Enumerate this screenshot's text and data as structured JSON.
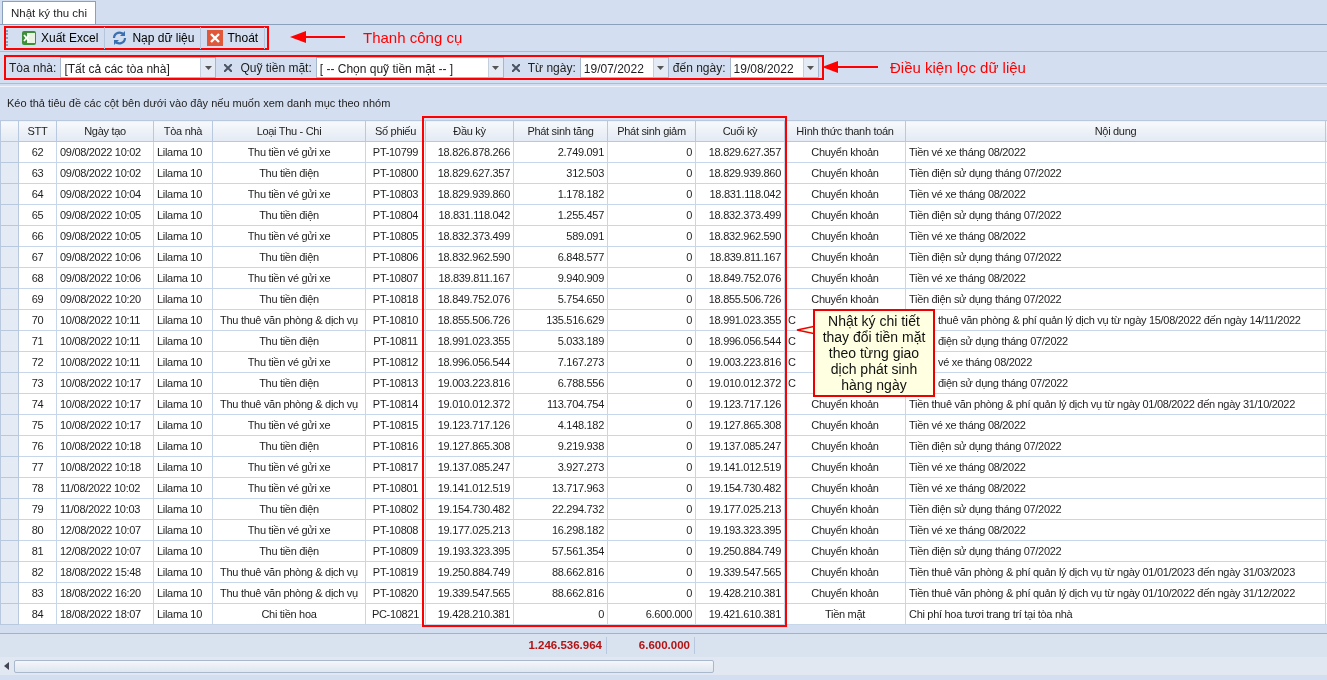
{
  "tabs": [
    {
      "label": "Nhật ký thu chi",
      "selected": true
    }
  ],
  "toolbar": {
    "buttons": [
      {
        "kind": "excel",
        "label": "Xuất Excel"
      },
      {
        "kind": "reload",
        "label": "Nạp dữ liệu"
      },
      {
        "kind": "exit",
        "label": "Thoát"
      }
    ],
    "note": "Thanh công cụ"
  },
  "filters": {
    "building": {
      "label": "Tòa nhà:",
      "value": "[Tất cả các tòa nhà]"
    },
    "cash_fund": {
      "label": "Quỹ tiền mặt:",
      "value": "[ -- Chọn quỹ tiền mặt -- ]"
    },
    "date_from": {
      "label": "Từ ngày:",
      "value": "19/07/2022"
    },
    "date_to": {
      "label": "đến ngày:",
      "value": "19/08/2022"
    },
    "note": "Điều kiện lọc dữ liệu"
  },
  "grid": {
    "group_hint": "Kéo thả tiêu đề các cột bên dưới vào đây nếu muốn xem danh mục theo nhóm",
    "columns": [
      "STT",
      "Ngày tạo",
      "Tòa nhà",
      "Loại Thu - Chi",
      "Số phiếu",
      "Đầu kỳ",
      "Phát sinh tăng",
      "Phát sinh giảm",
      "Cuối kỳ",
      "Hình thức thanh toán",
      "Nội dung"
    ],
    "rows": [
      {
        "stt": "62",
        "created": "09/08/2022 10:02",
        "building": "Lilama 10",
        "type": "Thu tiền vé gửi xe",
        "voucher": "PT-10799",
        "opening": "18.826.878.266",
        "increase": "2.749.091",
        "decrease": "0",
        "closing": "18.829.627.357",
        "payment": "Chuyển khoản",
        "content": "Tiền vé xe tháng 08/2022",
        "covered": false
      },
      {
        "stt": "63",
        "created": "09/08/2022 10:02",
        "building": "Lilama 10",
        "type": "Thu tiền điện",
        "voucher": "PT-10800",
        "opening": "18.829.627.357",
        "increase": "312.503",
        "decrease": "0",
        "closing": "18.829.939.860",
        "payment": "Chuyển khoản",
        "content": "Tiền điện sử dụng tháng 07/2022",
        "covered": false
      },
      {
        "stt": "64",
        "created": "09/08/2022 10:04",
        "building": "Lilama 10",
        "type": "Thu tiền vé gửi xe",
        "voucher": "PT-10803",
        "opening": "18.829.939.860",
        "increase": "1.178.182",
        "decrease": "0",
        "closing": "18.831.118.042",
        "payment": "Chuyển khoản",
        "content": "Tiền vé xe tháng 08/2022",
        "covered": false
      },
      {
        "stt": "65",
        "created": "09/08/2022 10:05",
        "building": "Lilama 10",
        "type": "Thu tiền điện",
        "voucher": "PT-10804",
        "opening": "18.831.118.042",
        "increase": "1.255.457",
        "decrease": "0",
        "closing": "18.832.373.499",
        "payment": "Chuyển khoản",
        "content": "Tiền điện sử dụng tháng 07/2022",
        "covered": false
      },
      {
        "stt": "66",
        "created": "09/08/2022 10:05",
        "building": "Lilama 10",
        "type": "Thu tiền vé gửi xe",
        "voucher": "PT-10805",
        "opening": "18.832.373.499",
        "increase": "589.091",
        "decrease": "0",
        "closing": "18.832.962.590",
        "payment": "Chuyển khoản",
        "content": "Tiền vé xe tháng 08/2022",
        "covered": false
      },
      {
        "stt": "67",
        "created": "09/08/2022 10:06",
        "building": "Lilama 10",
        "type": "Thu tiền điện",
        "voucher": "PT-10806",
        "opening": "18.832.962.590",
        "increase": "6.848.577",
        "decrease": "0",
        "closing": "18.839.811.167",
        "payment": "Chuyển khoản",
        "content": "Tiền điện sử dụng tháng 07/2022",
        "covered": false
      },
      {
        "stt": "68",
        "created": "09/08/2022 10:06",
        "building": "Lilama 10",
        "type": "Thu tiền vé gửi xe",
        "voucher": "PT-10807",
        "opening": "18.839.811.167",
        "increase": "9.940.909",
        "decrease": "0",
        "closing": "18.849.752.076",
        "payment": "Chuyển khoản",
        "content": "Tiền vé xe tháng 08/2022",
        "covered": false
      },
      {
        "stt": "69",
        "created": "09/08/2022 10:20",
        "building": "Lilama 10",
        "type": "Thu tiền điện",
        "voucher": "PT-10818",
        "opening": "18.849.752.076",
        "increase": "5.754.650",
        "decrease": "0",
        "closing": "18.855.506.726",
        "payment": "Chuyển khoản",
        "content": "Tiền điện sử dụng tháng 07/2022",
        "covered": false
      },
      {
        "stt": "70",
        "created": "10/08/2022 10:11",
        "building": "Lilama 10",
        "type": "Thu thuê văn phòng & dịch vụ",
        "voucher": "PT-10810",
        "opening": "18.855.506.726",
        "increase": "135.516.629",
        "decrease": "0",
        "closing": "18.991.023.355",
        "payment": "C",
        "content": "thuê văn phòng & phí quản lý dịch vụ từ ngày 15/08/2022 đến ngày 14/11/2022",
        "covered": true
      },
      {
        "stt": "71",
        "created": "10/08/2022 10:11",
        "building": "Lilama 10",
        "type": "Thu tiền điện",
        "voucher": "PT-10811",
        "opening": "18.991.023.355",
        "increase": "5.033.189",
        "decrease": "0",
        "closing": "18.996.056.544",
        "payment": "C",
        "content": "điện sử dụng tháng 07/2022",
        "covered": true
      },
      {
        "stt": "72",
        "created": "10/08/2022 10:11",
        "building": "Lilama 10",
        "type": "Thu tiền vé gửi xe",
        "voucher": "PT-10812",
        "opening": "18.996.056.544",
        "increase": "7.167.273",
        "decrease": "0",
        "closing": "19.003.223.816",
        "payment": "C",
        "content": "vé xe tháng 08/2022",
        "covered": true
      },
      {
        "stt": "73",
        "created": "10/08/2022 10:17",
        "building": "Lilama 10",
        "type": "Thu tiền điện",
        "voucher": "PT-10813",
        "opening": "19.003.223.816",
        "increase": "6.788.556",
        "decrease": "0",
        "closing": "19.010.012.372",
        "payment": "C",
        "content": "điện sử dụng tháng 07/2022",
        "covered": true
      },
      {
        "stt": "74",
        "created": "10/08/2022 10:17",
        "building": "Lilama 10",
        "type": "Thu thuê văn phòng & dịch vụ",
        "voucher": "PT-10814",
        "opening": "19.010.012.372",
        "increase": "113.704.754",
        "decrease": "0",
        "closing": "19.123.717.126",
        "payment": "Chuyển khoản",
        "content": "Tiền thuê văn phòng & phí quản lý dịch vụ từ ngày 01/08/2022 đến ngày 31/10/2022",
        "covered": false
      },
      {
        "stt": "75",
        "created": "10/08/2022 10:17",
        "building": "Lilama 10",
        "type": "Thu tiền vé gửi xe",
        "voucher": "PT-10815",
        "opening": "19.123.717.126",
        "increase": "4.148.182",
        "decrease": "0",
        "closing": "19.127.865.308",
        "payment": "Chuyển khoản",
        "content": "Tiền vé xe tháng 08/2022",
        "covered": false
      },
      {
        "stt": "76",
        "created": "10/08/2022 10:18",
        "building": "Lilama 10",
        "type": "Thu tiền điện",
        "voucher": "PT-10816",
        "opening": "19.127.865.308",
        "increase": "9.219.938",
        "decrease": "0",
        "closing": "19.137.085.247",
        "payment": "Chuyển khoản",
        "content": "Tiền điện sử dụng tháng 07/2022",
        "covered": false
      },
      {
        "stt": "77",
        "created": "10/08/2022 10:18",
        "building": "Lilama 10",
        "type": "Thu tiền vé gửi xe",
        "voucher": "PT-10817",
        "opening": "19.137.085.247",
        "increase": "3.927.273",
        "decrease": "0",
        "closing": "19.141.012.519",
        "payment": "Chuyển khoản",
        "content": "Tiền vé xe tháng 08/2022",
        "covered": false
      },
      {
        "stt": "78",
        "created": "11/08/2022 10:02",
        "building": "Lilama 10",
        "type": "Thu tiền vé gửi xe",
        "voucher": "PT-10801",
        "opening": "19.141.012.519",
        "increase": "13.717.963",
        "decrease": "0",
        "closing": "19.154.730.482",
        "payment": "Chuyển khoản",
        "content": "Tiền vé xe tháng 08/2022",
        "covered": false
      },
      {
        "stt": "79",
        "created": "11/08/2022 10:03",
        "building": "Lilama 10",
        "type": "Thu tiền điện",
        "voucher": "PT-10802",
        "opening": "19.154.730.482",
        "increase": "22.294.732",
        "decrease": "0",
        "closing": "19.177.025.213",
        "payment": "Chuyển khoản",
        "content": "Tiền điện sử dụng tháng 07/2022",
        "covered": false
      },
      {
        "stt": "80",
        "created": "12/08/2022 10:07",
        "building": "Lilama 10",
        "type": "Thu tiền vé gửi xe",
        "voucher": "PT-10808",
        "opening": "19.177.025.213",
        "increase": "16.298.182",
        "decrease": "0",
        "closing": "19.193.323.395",
        "payment": "Chuyển khoản",
        "content": "Tiền vé xe tháng 08/2022",
        "covered": false
      },
      {
        "stt": "81",
        "created": "12/08/2022 10:07",
        "building": "Lilama 10",
        "type": "Thu tiền điện",
        "voucher": "PT-10809",
        "opening": "19.193.323.395",
        "increase": "57.561.354",
        "decrease": "0",
        "closing": "19.250.884.749",
        "payment": "Chuyển khoản",
        "content": "Tiền điện sử dụng tháng 07/2022",
        "covered": false
      },
      {
        "stt": "82",
        "created": "18/08/2022 15:48",
        "building": "Lilama 10",
        "type": "Thu thuê văn phòng & dịch vụ",
        "voucher": "PT-10819",
        "opening": "19.250.884.749",
        "increase": "88.662.816",
        "decrease": "0",
        "closing": "19.339.547.565",
        "payment": "Chuyển khoản",
        "content": "Tiền thuê văn phòng & phí quản lý dịch vụ từ ngày 01/01/2023 đến ngày 31/03/2023",
        "covered": false
      },
      {
        "stt": "83",
        "created": "18/08/2022 16:20",
        "building": "Lilama 10",
        "type": "Thu thuê văn phòng & dịch vụ",
        "voucher": "PT-10820",
        "opening": "19.339.547.565",
        "increase": "88.662.816",
        "decrease": "0",
        "closing": "19.428.210.381",
        "payment": "Chuyển khoản",
        "content": "Tiền thuê văn phòng & phí quản lý dịch vụ từ ngày 01/10/2022 đến ngày 31/12/2022",
        "covered": false
      },
      {
        "stt": "84",
        "created": "18/08/2022 18:07",
        "building": "Lilama 10",
        "type": "Chi tiền hoa",
        "voucher": "PC-10821",
        "opening": "19.428.210.381",
        "increase": "0",
        "decrease": "6.600.000",
        "closing": "19.421.610.381",
        "payment": "Tiền mặt",
        "content": "Chi phí hoa tươi trang trí tại tòa nhà",
        "covered": false
      }
    ],
    "totals": {
      "increase": "1.246.536.964",
      "decrease": "6.600.000"
    },
    "callout": "Nhật ký chi tiết thay đổi tiền mặt theo từng giao dịch phát sinh hàng ngày"
  }
}
